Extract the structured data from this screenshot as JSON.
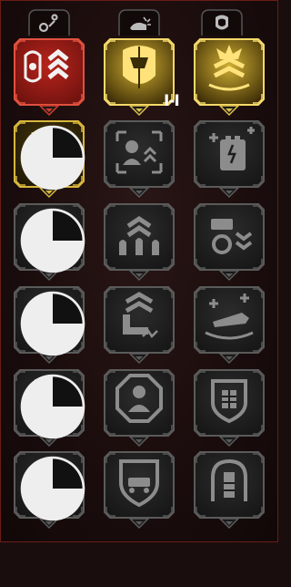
{
  "branches": [
    {
      "name": "branch-explore",
      "icon": "gear-nodes-icon",
      "color": "#8a8a8a"
    },
    {
      "name": "branch-combat",
      "icon": "fist-bang-icon",
      "color": "#8a8a8a"
    },
    {
      "name": "branch-defense",
      "icon": "helmet-shield-icon",
      "color": "#8a8a8a"
    }
  ],
  "tree": [
    [
      {
        "icon": "beetle-chevrons-icon",
        "state": "active-red",
        "fill": 1
      },
      {
        "icon": "split-helmet-icon",
        "state": "active-gold",
        "fill": 1
      },
      {
        "icon": "burst-chevrons-icon",
        "state": "active-gold",
        "fill": 1
      }
    ],
    [
      {
        "icon": "fortress-chevron-icon",
        "state": "gold-outline",
        "fill": 0.25
      },
      {
        "icon": "scanner-soldier-icon",
        "state": "locked",
        "fill": 0
      },
      {
        "icon": "battery-plus-icon",
        "state": "locked",
        "fill": 0
      }
    ],
    [
      {
        "icon": "gear-hammer-icon",
        "state": "locked",
        "fill": 0.25
      },
      {
        "icon": "ammo-chevrons-icon",
        "state": "locked",
        "fill": 0
      },
      {
        "icon": "tank-chevrons-icon",
        "state": "locked",
        "fill": 0
      }
    ],
    [
      {
        "icon": "lightning-chevron-icon",
        "state": "locked",
        "fill": 0.25
      },
      {
        "icon": "boot-chevrons-icon",
        "state": "locked",
        "fill": 0
      },
      {
        "icon": "vehicle-plus-icon",
        "state": "locked",
        "fill": 0
      }
    ],
    [
      {
        "icon": "trooper-mask-icon",
        "state": "locked",
        "fill": 0.25
      },
      {
        "icon": "octagon-soldier-icon",
        "state": "locked",
        "fill": 0
      },
      {
        "icon": "shield-grid-icon",
        "state": "locked",
        "fill": 0
      }
    ],
    [
      {
        "icon": "credit-stacks-icon",
        "state": "locked",
        "fill": 0.25
      },
      {
        "icon": "shield-rover-icon",
        "state": "locked",
        "fill": 0
      },
      {
        "icon": "rocket-arch-icon",
        "state": "locked",
        "fill": 0
      }
    ]
  ],
  "cursor_text": "I-I",
  "colors": {
    "red": "#b2281f",
    "gold": "#d7b83a",
    "grey": "#4a4a4a",
    "glow": "#ffe06a"
  }
}
